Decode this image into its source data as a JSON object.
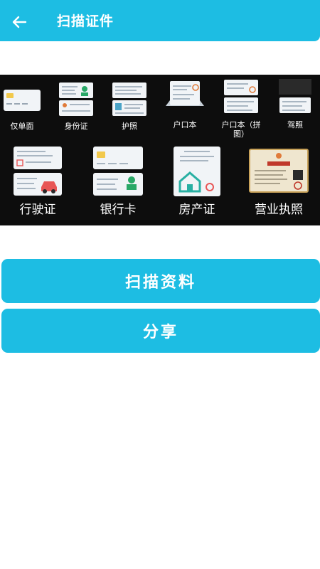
{
  "header": {
    "title": "扫描证件",
    "back_icon": "arrow-left-icon",
    "background": "#1dbde3"
  },
  "documents": {
    "row1": [
      {
        "label": "仅单面",
        "icon": "single-side-card-icon"
      },
      {
        "label": "身份证",
        "icon": "id-card-icon"
      },
      {
        "label": "护照",
        "icon": "passport-icon"
      },
      {
        "label": "户口本",
        "icon": "household-register-icon"
      },
      {
        "label": "户口本（拼图）",
        "label_line1": "户口本（拼",
        "label_line2": "图）",
        "icon": "household-register-collage-icon"
      },
      {
        "label": "驾照",
        "icon": "driver-license-icon"
      }
    ],
    "row2": [
      {
        "label": "行驶证",
        "icon": "vehicle-license-icon"
      },
      {
        "label": "银行卡",
        "icon": "bank-card-icon"
      },
      {
        "label": "房产证",
        "icon": "property-certificate-icon"
      },
      {
        "label": "营业执照",
        "icon": "business-license-icon"
      }
    ]
  },
  "actions": {
    "scan_label": "扫描资料",
    "share_label": "分享"
  },
  "colors": {
    "accent": "#1dbde3",
    "panel": "#0d0d0d",
    "text_on_accent": "#ffffff"
  }
}
